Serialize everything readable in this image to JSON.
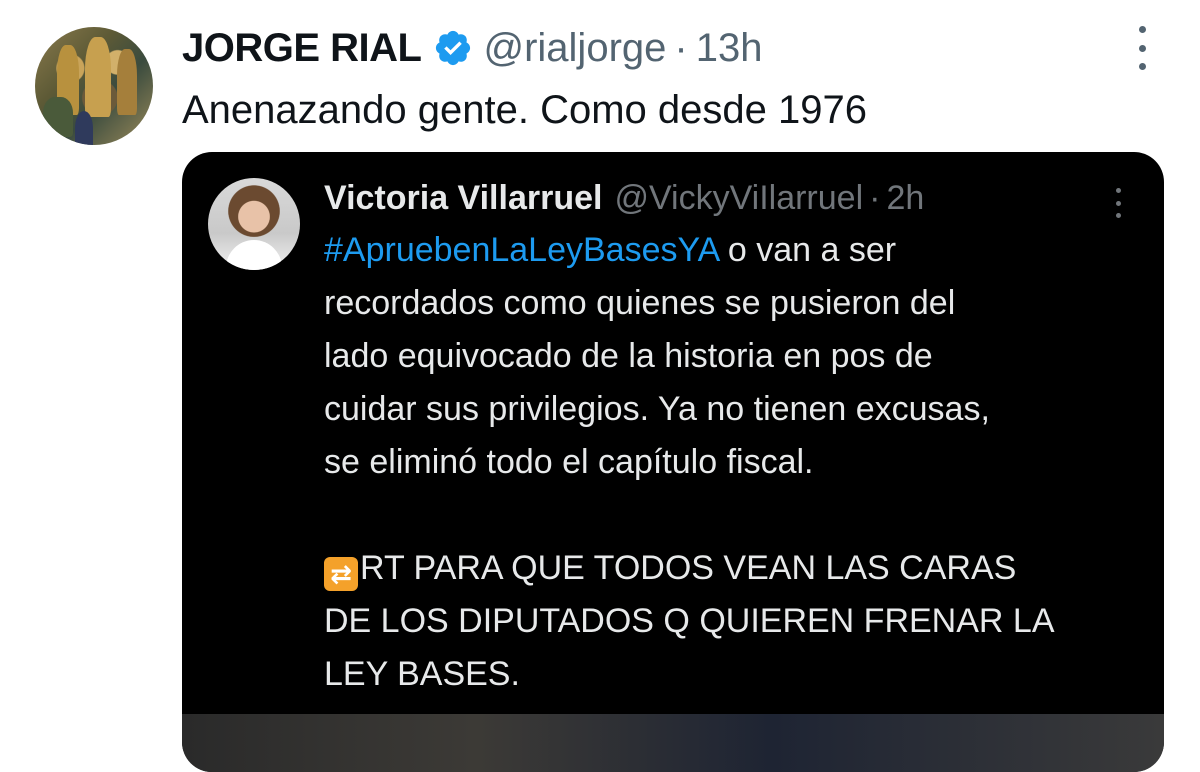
{
  "tweet": {
    "author_name": "JORGE RIAL",
    "handle": "@rialjorge",
    "separator": "·",
    "time": "13h",
    "text": "Anenazando gente. Como desde 1976"
  },
  "quoted_tweet": {
    "author_name": "Victoria Villarruel",
    "handle": "@VickyViIlarruel",
    "separator": "·",
    "time": "2h",
    "hashtag": "#ApruebenLaLeyBasesYA",
    "line1_rest": " o van a ser",
    "line2": "recordados como quienes se pusieron del",
    "line3": "lado equivocado de la historia en pos de",
    "line4": "cuidar sus privilegios. Ya no tienen excusas,",
    "line5": "se eliminó todo el capítulo fiscal.",
    "rt_emoji": "⇄",
    "rt_line1": "RT PARA QUE TODOS VEAN LAS CARAS",
    "rt_line2": "DE LOS DIPUTADOS Q QUIEREN FRENAR LA",
    "rt_line3": "LEY BASES."
  },
  "icons": {
    "verified": "verified-badge-icon",
    "more": "more-options-icon"
  },
  "colors": {
    "verified_blue": "#1d9bf0",
    "hashtag_blue": "#1d9bf0",
    "secondary_text": "#536471",
    "quote_background": "#000000"
  }
}
